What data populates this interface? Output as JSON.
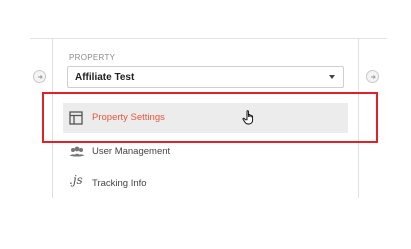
{
  "property": {
    "section_label": "PROPERTY",
    "selected_value": "Affiliate Test"
  },
  "menu": {
    "items": [
      {
        "label": "Property Settings",
        "icon": "property-settings-icon",
        "active": true
      },
      {
        "label": "User Management",
        "icon": "users-icon",
        "active": false
      },
      {
        "label": "Tracking Info",
        "icon": "js-icon",
        "icon_text": ".js",
        "active": false
      }
    ]
  },
  "colors": {
    "active_text": "#e8573c",
    "highlight_border": "#e0202a",
    "active_bg": "#ececec"
  }
}
